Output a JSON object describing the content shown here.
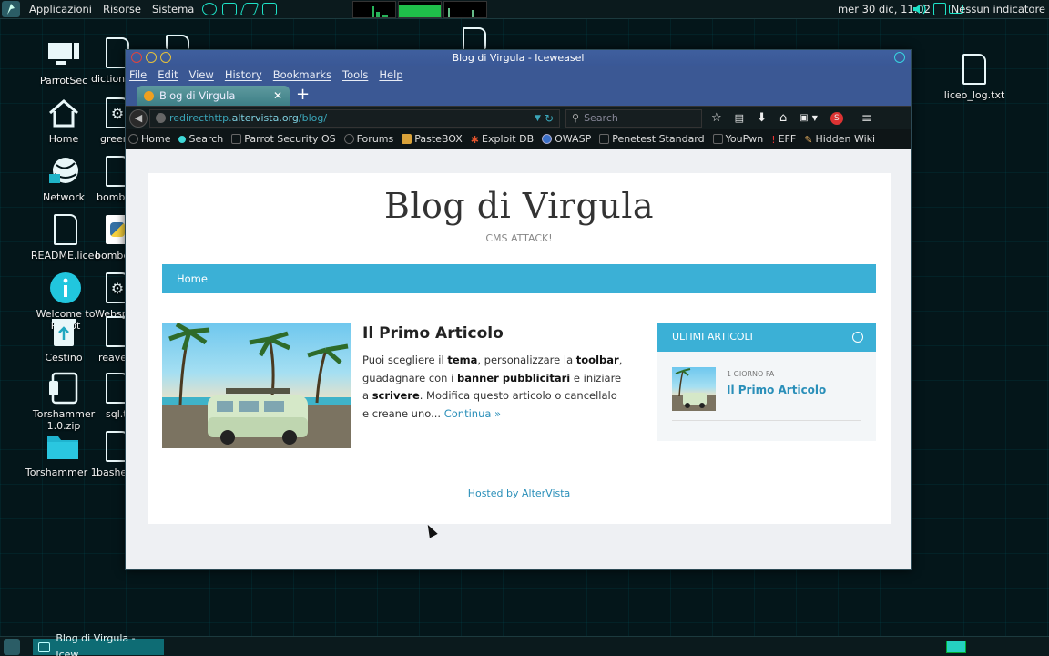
{
  "top_panel": {
    "menus": [
      "Applicazioni",
      "Risorse",
      "Sistema"
    ],
    "clock": "mer 30 dic, 11.02",
    "indicator": "Nessun indicatore"
  },
  "desktop": {
    "icons": [
      {
        "label": "ParrotSec",
        "icon": "monitor-icon"
      },
      {
        "label": "dictionar",
        "icon": "file-icon"
      },
      {
        "label": "Home",
        "icon": "home-icon"
      },
      {
        "label": "greer",
        "icon": "gear-icon"
      },
      {
        "label": "Network",
        "icon": "network-icon"
      },
      {
        "label": "bomb",
        "icon": "file-icon"
      },
      {
        "label": "README.liceo",
        "icon": "file-icon"
      },
      {
        "label": "bomberr",
        "icon": "python-icon"
      },
      {
        "label": "Welcome to Parrot",
        "icon": "info-icon"
      },
      {
        "label": "WebsploitF",
        "icon": "gear-icon"
      },
      {
        "label": "Cestino",
        "icon": "trash-icon"
      },
      {
        "label": "reave",
        "icon": "file-icon"
      },
      {
        "label": "Torshammer 1.0.zip",
        "icon": "archive-icon"
      },
      {
        "label": "sql.t",
        "icon": "file-icon"
      },
      {
        "label": "Torshammer 1.",
        "icon": "folder-icon"
      },
      {
        "label": "bashe",
        "icon": "file-icon"
      },
      {
        "label": "liceo_log.txt",
        "icon": "file-icon"
      }
    ]
  },
  "browser": {
    "window_title": "Blog di Virgula - Iceweasel",
    "menu": [
      "File",
      "Edit",
      "View",
      "History",
      "Bookmarks",
      "Tools",
      "Help"
    ],
    "tab_title": "Blog di Virgula",
    "url": {
      "prefix": "redirecthttp.",
      "domain": "altervista.org",
      "path": "/blog/"
    },
    "search_placeholder": "Search",
    "bookmarks": [
      "Home",
      "Search",
      "Parrot Security OS",
      "Forums",
      "PasteBOX",
      "Exploit DB",
      "OWASP",
      "Penetest Standard",
      "YouPwn",
      "EFF",
      "Hidden Wiki"
    ]
  },
  "page": {
    "site_title": "Blog di Virgula",
    "site_desc": "CMS ATTACK!",
    "nav_home": "Home",
    "post": {
      "title": "Il Primo Articolo",
      "excerpt_parts": [
        {
          "t": "Puoi scegliere il ",
          "b": false
        },
        {
          "t": "tema",
          "b": true
        },
        {
          "t": ", personalizzare la ",
          "b": false
        },
        {
          "t": "toolbar",
          "b": true
        },
        {
          "t": ", guadagnare con i ",
          "b": false
        },
        {
          "t": "banner pubblicitari",
          "b": true
        },
        {
          "t": " e iniziare a ",
          "b": false
        },
        {
          "t": "scrivere",
          "b": true
        },
        {
          "t": ". Modifica questo articolo o cancellalo e creane uno... ",
          "b": false
        }
      ],
      "more": "Continua »"
    },
    "widget": {
      "title": "ULTIMI ARTICOLI",
      "date": "1 GIORNO FA",
      "link": "Il Primo Articolo"
    },
    "footer": "Hosted by AlterVista"
  },
  "taskbar": {
    "task": "Blog di Virgula - Icew..."
  },
  "colors": {
    "accent": "#3bb0d6",
    "link": "#2a8fb9",
    "title_bar": "#3b5894"
  }
}
